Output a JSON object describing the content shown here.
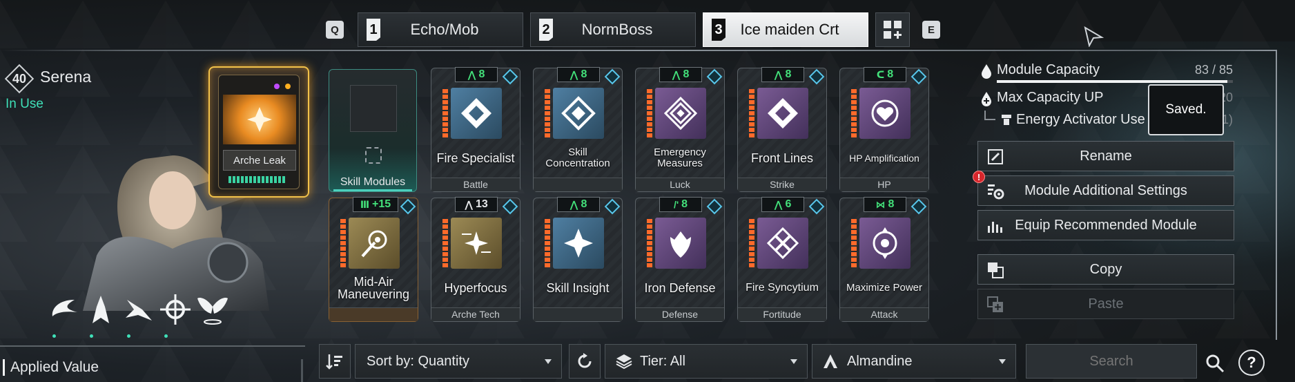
{
  "tabs": {
    "key_left": "Q",
    "key_right": "E",
    "presets": [
      {
        "num": "1",
        "label": "Echo/Mob",
        "active": false
      },
      {
        "num": "2",
        "label": "NormBoss",
        "active": false
      },
      {
        "num": "3",
        "label": "Ice maiden Crt",
        "active": true
      }
    ]
  },
  "character": {
    "level": "40",
    "name": "Serena",
    "status": "In Use"
  },
  "reactor": {
    "name": "Arche Leak"
  },
  "empty_slot": {
    "label": "Skill Modules"
  },
  "modules": [
    {
      "name": "Fire Specialist",
      "base": "Battle",
      "cost": "8",
      "cost_symbol": "⋀",
      "icon_color": "blue"
    },
    {
      "name": "Skill Concentration",
      "base": "",
      "cost": "8",
      "cost_symbol": "⋀",
      "icon_color": "blue"
    },
    {
      "name": "Emergency Measures",
      "base": "Luck",
      "cost": "8",
      "cost_symbol": "⋀",
      "icon_color": "purple"
    },
    {
      "name": "Front Lines",
      "base": "Strike",
      "cost": "8",
      "cost_symbol": "⋀",
      "icon_color": "purple"
    },
    {
      "name": "HP Amplification",
      "base": "HP",
      "cost": "8",
      "cost_symbol": "ᑕ",
      "icon_color": "purple"
    },
    {
      "name": "Mid-Air Maneuvering",
      "base": "",
      "cost": "+15",
      "cost_symbol": "Ⅲ",
      "icon_color": "gold"
    },
    {
      "name": "Hyperfocus",
      "base": "Arche Tech",
      "cost": "13",
      "cost_symbol": "⋀",
      "icon_color": "gold"
    },
    {
      "name": "Skill Insight",
      "base": "",
      "cost": "8",
      "cost_symbol": "⋀",
      "icon_color": "blue"
    },
    {
      "name": "Iron Defense",
      "base": "Defense",
      "cost": "8",
      "cost_symbol": "/'",
      "icon_color": "purple"
    },
    {
      "name": "Fire Syncytium",
      "base": "Fortitude",
      "cost": "6",
      "cost_symbol": "⋀",
      "icon_color": "purple"
    },
    {
      "name": "Maximize Power",
      "base": "Attack",
      "cost": "8",
      "cost_symbol": "⋈",
      "icon_color": "purple"
    }
  ],
  "capacity": {
    "label": "Module Capacity",
    "value": "83 / 85",
    "fill_fraction": 0.976,
    "max_up_label": "Max Capacity UP",
    "max_up_value": "+ 20",
    "activator_label": "Energy Activator Use Count",
    "activator_value": "(1/1)",
    "toast": "Saved."
  },
  "actions": {
    "rename": "Rename",
    "additional_settings": "Module Additional Settings",
    "alert": "!",
    "equip_recommended": "Equip Recommended Module",
    "copy": "Copy",
    "paste": "Paste"
  },
  "bottom": {
    "applied_value": "Applied Value",
    "sort": "Sort by: Quantity",
    "tier": "Tier: All",
    "socket": "Almandine",
    "search_placeholder": "Search",
    "help": "?"
  },
  "colors": {
    "accent_green": "#3fe0b8",
    "cost_green": "#43e07a",
    "reactor_gold": "#f2c24a",
    "orange_bars": "#ff6a2a",
    "alert_red": "#d7262c"
  }
}
